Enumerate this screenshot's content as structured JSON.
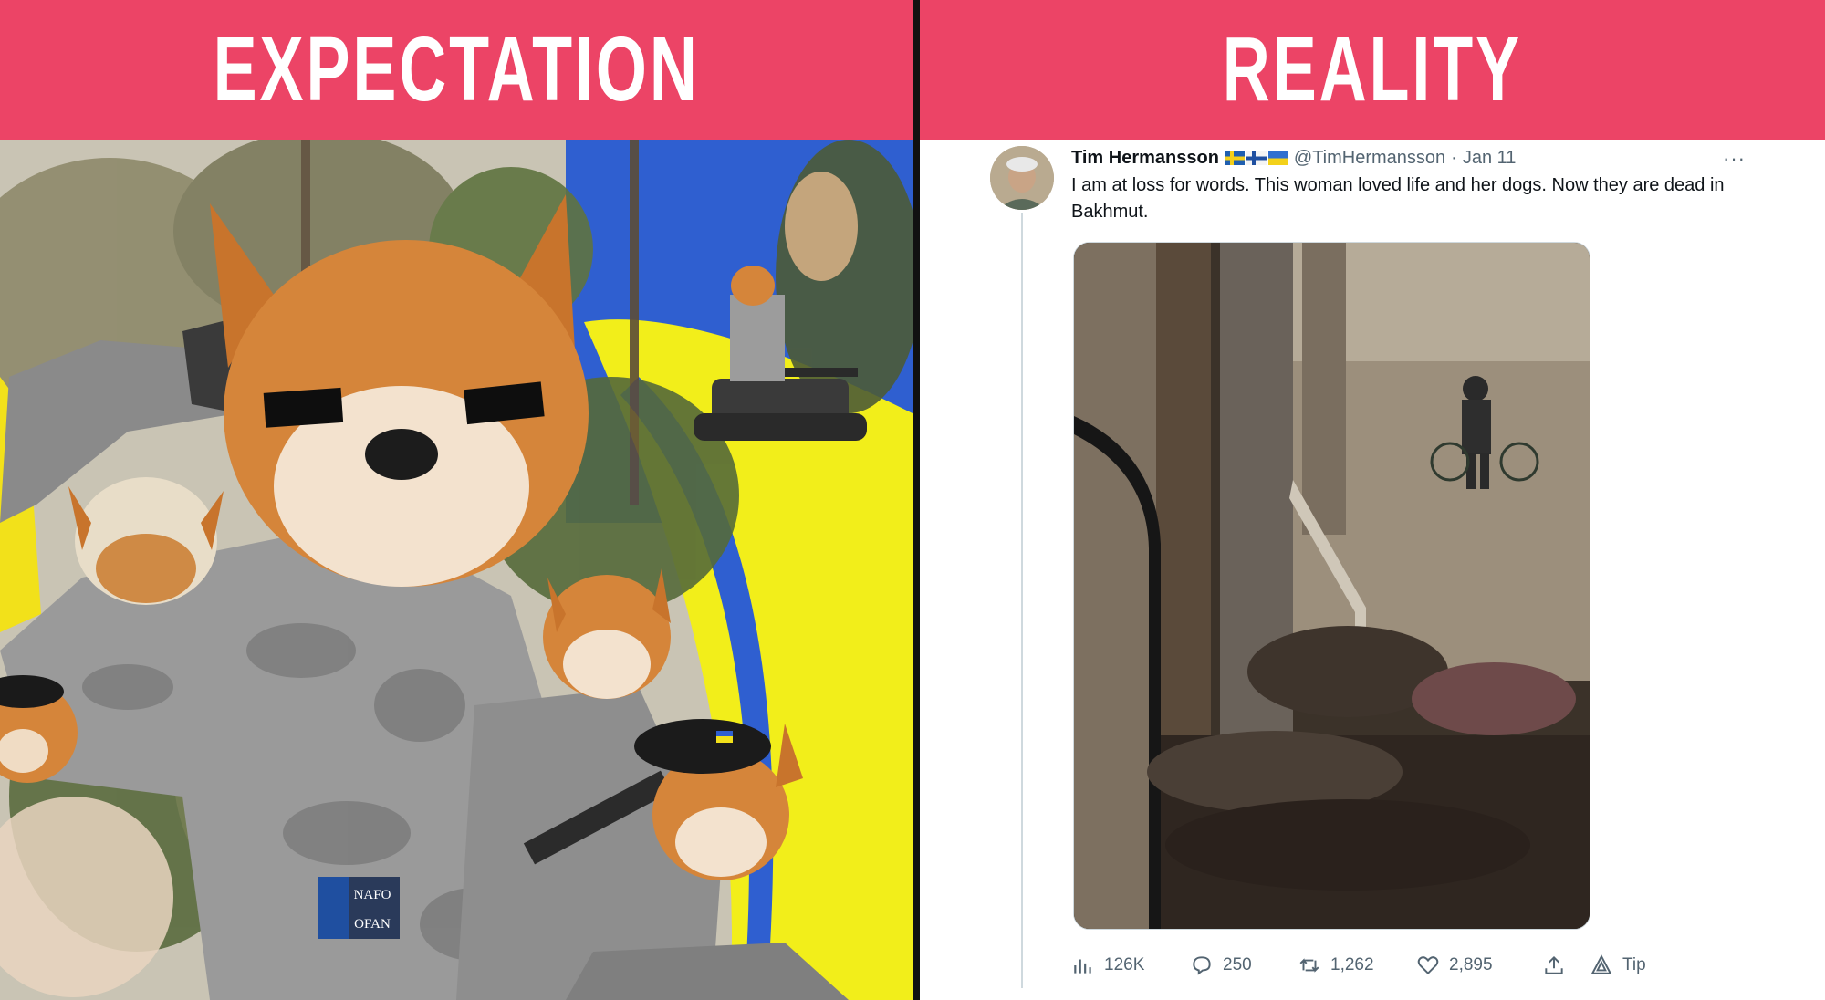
{
  "left_panel": {
    "banner_label": "EXPECTATION",
    "banner_color": "#ec4466",
    "badge_line1": "NAFO",
    "badge_line2": "OFAN"
  },
  "right_panel": {
    "banner_label": "REALITY",
    "banner_color": "#ec4466"
  },
  "tweet": {
    "author_name": "Tim Hermansson",
    "author_flags": [
      "flag-sweden-icon",
      "flag-finland-icon",
      "flag-ukraine-icon"
    ],
    "handle": "@TimHermansson",
    "separator": "·",
    "date": "Jan 11",
    "more_label": "···",
    "text": "I am at loss for words. This woman loved life and her dogs. Now they are dead in Bakhmut.",
    "actions": {
      "views": "126K",
      "replies": "250",
      "retweets": "1,262",
      "likes": "2,895",
      "tip": "Tip"
    }
  },
  "colors": {
    "sky_blue": "#2f5fd0",
    "bright_yellow": "#f2ee1a",
    "twitter_gray": "#536471",
    "divider": "#111111"
  }
}
